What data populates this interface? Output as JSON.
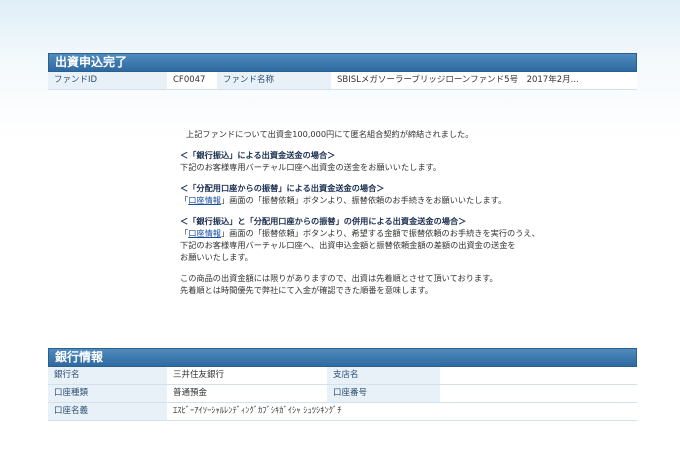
{
  "completion": {
    "title": "出資申込完了",
    "fund_id_label": "ファンドID",
    "fund_id_value": "CF0047",
    "fund_name_label": "ファンド名称",
    "fund_name_value": "SBISLメガソーラーブリッジローンファンド5号　2017年2月..."
  },
  "message": {
    "intro": "上記ファンドについて出資金100,000円にて匿名組合契約が締結されました。",
    "sec1_title": "＜「銀行振込」による出資金送金の場合＞",
    "sec1_body": "下記のお客様専用バーチャル口座へ出資金の送金をお願いいたします。",
    "sec2_title": "＜「分配用口座からの振替」による出資金送金の場合＞",
    "sec2_pre": "「",
    "sec2_link": "口座情報",
    "sec2_post": "」画面の「振替依頼」ボタンより、振替依頼のお手続きをお願いいたします。",
    "sec3_title": "＜「銀行振込」と「分配用口座からの振替」の併用による出資金送金の場合＞",
    "sec3_pre": "「",
    "sec3_link": "口座情報",
    "sec3_post": "」画面の「振替依頼」ボタンより、希望する金額で振替依頼のお手続きを実行のうえ、",
    "sec3_line2": "下記のお客様専用バーチャル口座へ、出資申込金額と振替依頼金額の差額の出資金の送金を",
    "sec3_line3": "お願いいたします。",
    "note1": "この商品の出資金額には限りがありますので、出資は先着順とさせて頂いております。",
    "note2": "先着順とは時間優先で弊社にて入金が確認できた順番を意味します。"
  },
  "bank": {
    "title": "銀行情報",
    "rows": [
      {
        "label1": "銀行名",
        "value1": "三井住友銀行",
        "label2": "支店名",
        "value2": ""
      },
      {
        "label1": "口座種類",
        "value1": "普通預金",
        "label2": "口座番号",
        "value2": ""
      },
      {
        "label1": "口座名義",
        "value1": "ｴｽﾋﾞｰｱｲｿｰｼｬﾙﾚﾝﾃﾞｨﾝｸﾞｶﾌﾞｼｷｶﾞｲｼｬ ｼｭﾂｼｷﾝｸﾞﾁ"
      }
    ]
  }
}
